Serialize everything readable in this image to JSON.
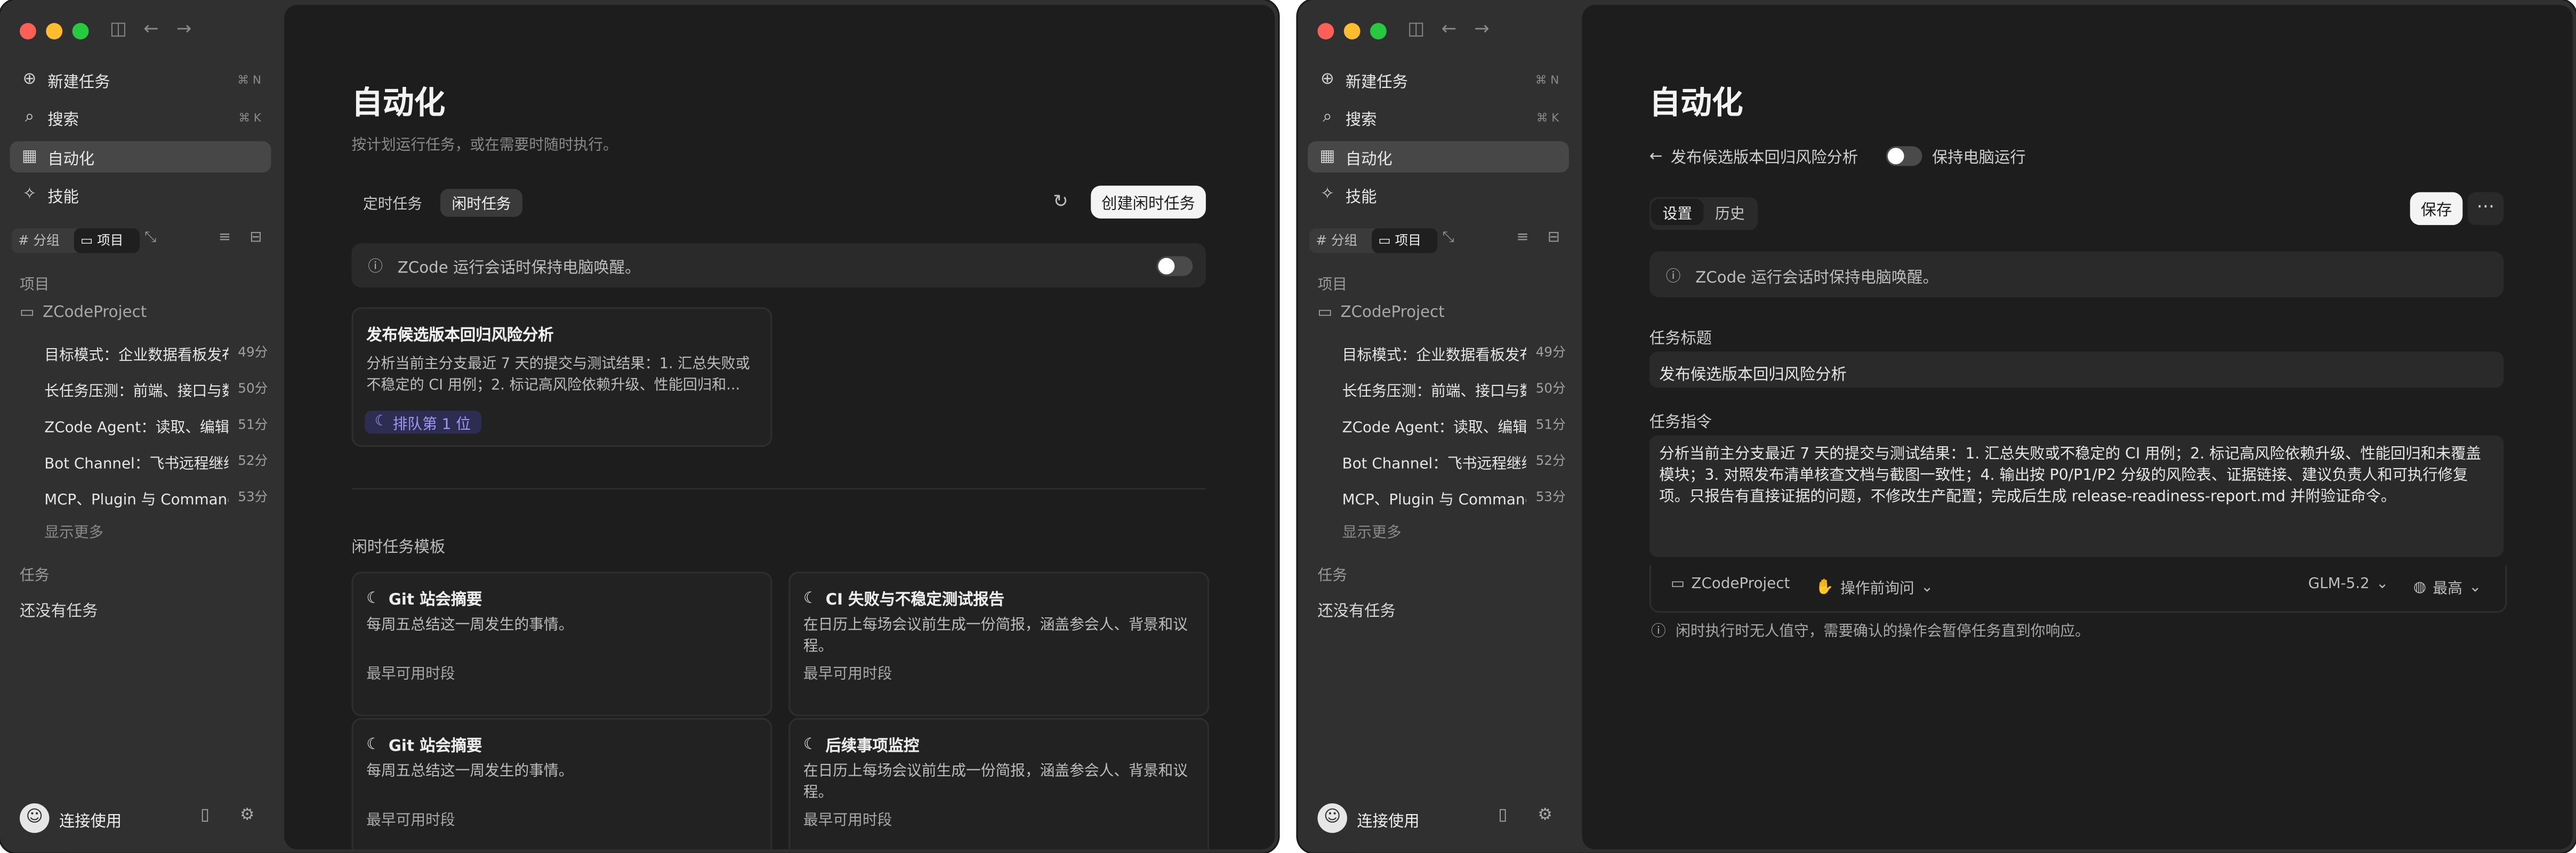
{
  "sidebar": {
    "nav": [
      {
        "label": "新建任务",
        "shortcut": "⌘ N",
        "icon": "new-task-icon"
      },
      {
        "label": "搜索",
        "shortcut": "⌘ K",
        "icon": "search-icon"
      },
      {
        "label": "自动化",
        "shortcut": "",
        "icon": "calendar-icon"
      },
      {
        "label": "技能",
        "shortcut": "",
        "icon": "magic-wand-icon"
      }
    ],
    "group_toggle": {
      "group": "分组",
      "project": "项目"
    },
    "projects_label": "项目",
    "project_name": "ZCodeProject",
    "tasks": [
      {
        "title": "目标模式：企业数据看板发布",
        "time": "49分"
      },
      {
        "title": "长任务压测：前端、接口与数据",
        "time": "50分"
      },
      {
        "title": "ZCode Agent：读取、编辑与运行",
        "time": "51分"
      },
      {
        "title": "Bot Channel：飞书远程继续任务",
        "time": "52分"
      },
      {
        "title": "MCP、Plugin 与 Command",
        "time": "53分"
      }
    ],
    "show_more": "显示更多",
    "tasks_label": "任务",
    "no_tasks": "还没有任务",
    "connect": "连接使用"
  },
  "left": {
    "title": "自动化",
    "subtitle": "按计划运行任务，或在需要时随时执行。",
    "tabs": [
      "定时任务",
      "闲时任务"
    ],
    "create_button": "创建闲时任务",
    "banner": "ZCode 运行会话时保持电脑唤醒。",
    "card": {
      "title": "发布候选版本回归风险分析",
      "desc": "分析当前主分支最近 7 天的提交与测试结果：1. 汇总失败或不稳定的 CI 用例；2. 标记高风险依赖升级、性能回归和...",
      "badge": "排队第 1 位"
    },
    "templates_label": "闲时任务模板",
    "templates": [
      {
        "title": "Git 站会摘要",
        "desc": "每周五总结这一周发生的事情。",
        "foot": "最早可用时段"
      },
      {
        "title": "CI 失败与不稳定测试报告",
        "desc": "在日历上每场会议前生成一份简报，涵盖参会人、背景和议程。",
        "foot": "最早可用时段"
      },
      {
        "title": "Git 站会摘要",
        "desc": "每周五总结这一周发生的事情。",
        "foot": "最早可用时段"
      },
      {
        "title": "后续事项监控",
        "desc": "在日历上每场会议前生成一份简报，涵盖参会人、背景和议程。",
        "foot": "最早可用时段"
      }
    ]
  },
  "right": {
    "title": "自动化",
    "back_label": "发布候选版本回归风险分析",
    "keep_awake": "保持电脑运行",
    "tabs": [
      "设置",
      "历史"
    ],
    "save": "保存",
    "banner": "ZCode 运行会话时保持电脑唤醒。",
    "title_label": "任务标题",
    "title_value": "发布候选版本回归风险分析",
    "prompt_label": "任务指令",
    "prompt_value": "分析当前主分支最近 7 天的提交与测试结果：1. 汇总失败或不稳定的 CI 用例；2. 标记高风险依赖升级、性能回归和未覆盖模块；3. 对照发布清单核查文档与截图一致性；4. 输出按 P0/P1/P2 分级的风险表、证据链接、建议负责人和可执行修复项。只报告有直接证据的问题，不修改生产配置；完成后生成 release-readiness-report.md 并附验证命令。",
    "toolbar": {
      "project": "ZCodeProject",
      "approval": "操作前询问",
      "model": "GLM-5.2",
      "effort": "最高"
    },
    "hint": "闲时执行时无人值守，需要确认的操作会暂停任务直到你响应。"
  }
}
